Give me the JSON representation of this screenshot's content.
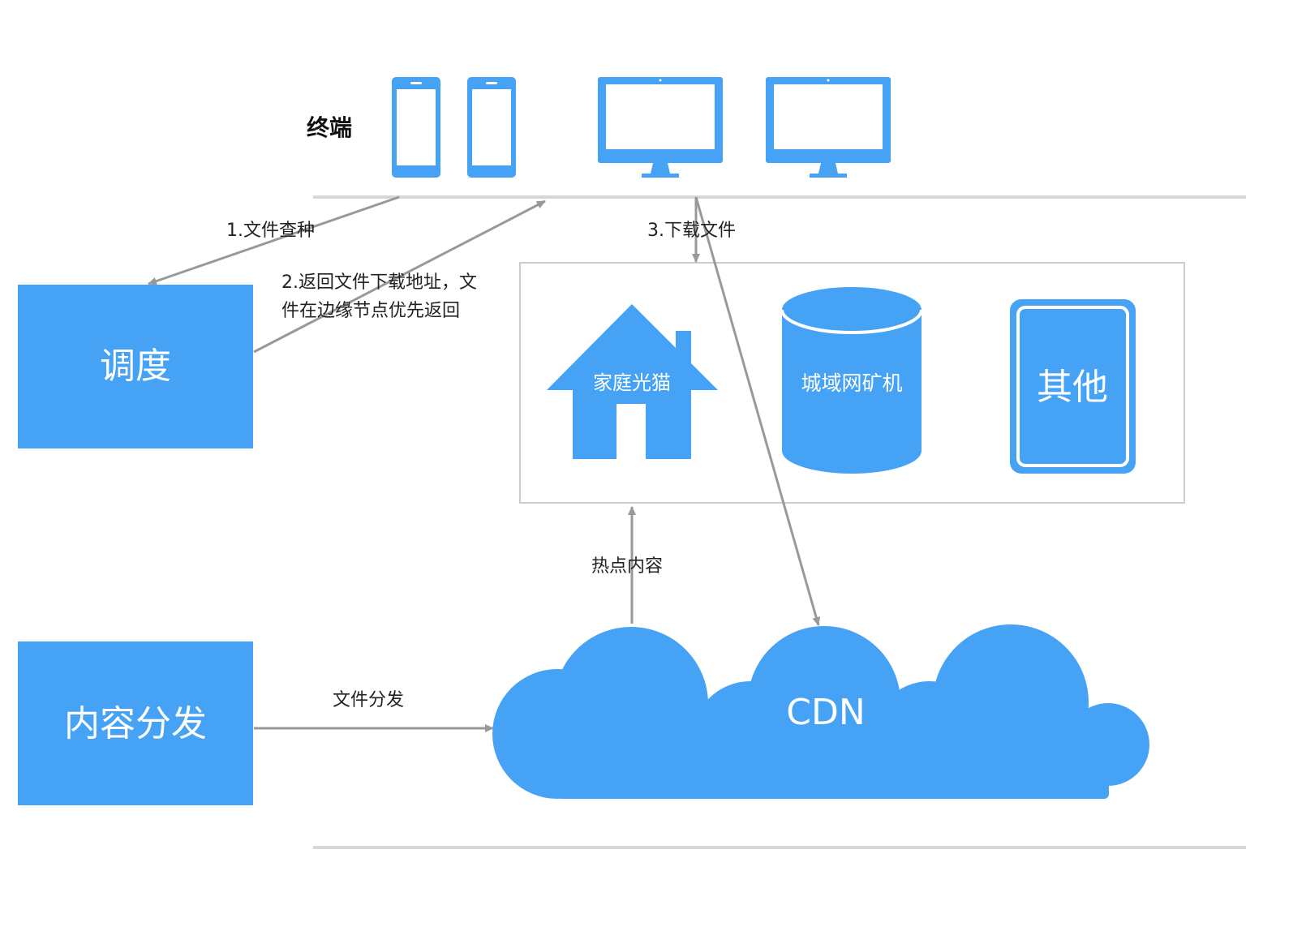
{
  "terminal_label": "终端",
  "dispatch_box": "调度",
  "distribution_box": "内容分发",
  "edge_nodes": {
    "home_modem": "家庭光猫",
    "metro_miner": "城域网矿机",
    "other": "其他"
  },
  "cdn_label": "CDN",
  "flows": {
    "step1": "1.文件查种",
    "step2_line1": "2.返回文件下载地址，文",
    "step2_line2": "件在边缘节点优先返回",
    "step3": "3.下载文件",
    "hot_content": "热点内容",
    "file_distribution": "文件分发"
  },
  "devices": [
    "phone-icon",
    "phone-icon",
    "monitor-icon",
    "monitor-icon"
  ],
  "colors": {
    "accent": "#46a2f5",
    "arrow": "#999999",
    "divider": "#d6d6d6",
    "frame": "#cccccc"
  }
}
